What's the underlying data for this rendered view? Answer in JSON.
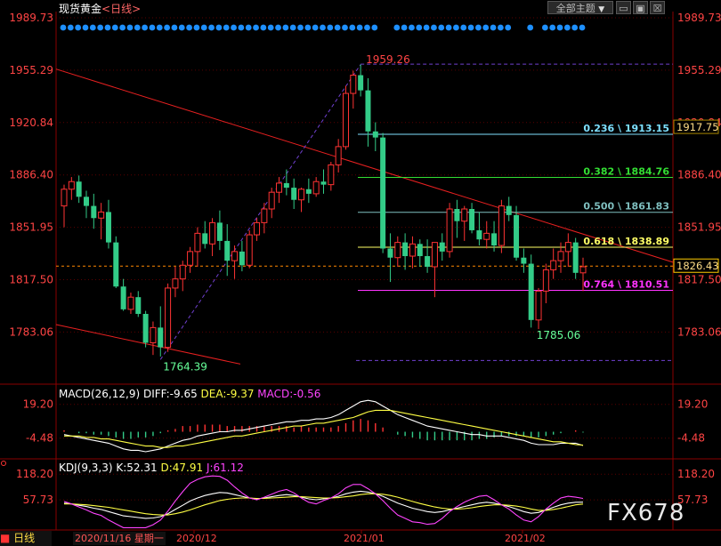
{
  "window": {
    "symbol": "现货黄金",
    "period": "<日线>",
    "panel_title": "日线"
  },
  "toolbar": {
    "dropdown_label": "全部主题",
    "icons": [
      "chevron-down-icon",
      "minimize-icon",
      "restore-icon",
      "close-icon"
    ]
  },
  "watermark": "FX678",
  "colors": {
    "up": "#ff3333",
    "down": "#33cc88",
    "grid": "#5a0000",
    "axis_text": "#ff4444",
    "trendline": "#e82020",
    "channel_dashed": "#7040d0",
    "bg": "#000000"
  },
  "status_bar": {
    "date": "2020/11/16 星期一",
    "x_labels": [
      "2020/12",
      "2021/01",
      "2021/02"
    ]
  },
  "chart_data": [
    {
      "type": "candlestick",
      "title": "现货黄金 日线",
      "ylim": [
        1764.0,
        1989.73
      ],
      "y_ticks": [
        1989.73,
        1955.29,
        1920.84,
        1886.4,
        1851.95,
        1817.5,
        1783.06
      ],
      "last_price": 1826.43,
      "last_price_label": "1826.43",
      "price_tag_1917": "1917.75",
      "annotations": {
        "high": "1959.26",
        "low": "1764.39",
        "low2": "1785.06"
      },
      "fibonacci": [
        {
          "label": "0.236 \\ 1913.15",
          "value": 1913.15,
          "color": "#7fe0ff"
        },
        {
          "label": "0.382 \\ 1884.76",
          "value": 1884.76,
          "color": "#33dd33"
        },
        {
          "label": "0.500 \\ 1861.83",
          "value": 1861.83,
          "color": "#7fbfbf"
        },
        {
          "label": "0.618 \\ 1838.89",
          "value": 1838.89,
          "color": "#ffff66"
        },
        {
          "label": "0.764 \\ 1810.51",
          "value": 1810.51,
          "color": "#ff33ff"
        }
      ],
      "candles": [
        [
          1866,
          1880,
          1852,
          1877
        ],
        [
          1877,
          1885,
          1870,
          1882
        ],
        [
          1882,
          1886,
          1868,
          1872
        ],
        [
          1872,
          1876,
          1858,
          1866
        ],
        [
          1866,
          1874,
          1851,
          1858
        ],
        [
          1858,
          1868,
          1844,
          1862
        ],
        [
          1862,
          1870,
          1838,
          1842
        ],
        [
          1842,
          1846,
          1812,
          1813
        ],
        [
          1813,
          1818,
          1797,
          1798
        ],
        [
          1798,
          1809,
          1795,
          1806
        ],
        [
          1806,
          1810,
          1793,
          1795
        ],
        [
          1795,
          1797,
          1773,
          1776
        ],
        [
          1776,
          1790,
          1768,
          1786
        ],
        [
          1786,
          1800,
          1767,
          1773
        ],
        [
          1773,
          1815,
          1770,
          1812
        ],
        [
          1812,
          1826,
          1806,
          1818
        ],
        [
          1818,
          1830,
          1810,
          1827
        ],
        [
          1827,
          1839,
          1822,
          1836
        ],
        [
          1836,
          1852,
          1826,
          1848
        ],
        [
          1848,
          1856,
          1838,
          1841
        ],
        [
          1841,
          1858,
          1833,
          1855
        ],
        [
          1855,
          1863,
          1837,
          1843
        ],
        [
          1843,
          1854,
          1820,
          1830
        ],
        [
          1830,
          1840,
          1818,
          1836
        ],
        [
          1836,
          1843,
          1823,
          1827
        ],
        [
          1827,
          1850,
          1825,
          1847
        ],
        [
          1847,
          1858,
          1843,
          1855
        ],
        [
          1855,
          1868,
          1848,
          1864
        ],
        [
          1864,
          1878,
          1858,
          1875
        ],
        [
          1875,
          1885,
          1868,
          1881
        ],
        [
          1881,
          1890,
          1873,
          1878
        ],
        [
          1878,
          1884,
          1864,
          1870
        ],
        [
          1870,
          1878,
          1862,
          1877
        ],
        [
          1877,
          1884,
          1868,
          1874
        ],
        [
          1874,
          1885,
          1872,
          1882
        ],
        [
          1882,
          1890,
          1874,
          1880
        ],
        [
          1880,
          1895,
          1876,
          1893
        ],
        [
          1893,
          1910,
          1888,
          1905
        ],
        [
          1905,
          1945,
          1903,
          1940
        ],
        [
          1940,
          1955,
          1930,
          1952
        ],
        [
          1952,
          1959,
          1938,
          1942
        ],
        [
          1942,
          1950,
          1905,
          1915
        ],
        [
          1915,
          1921,
          1902,
          1911
        ],
        [
          1911,
          1914,
          1835,
          1838
        ],
        [
          1838,
          1848,
          1816,
          1832
        ],
        [
          1832,
          1846,
          1826,
          1842
        ],
        [
          1842,
          1848,
          1824,
          1833
        ],
        [
          1833,
          1846,
          1825,
          1841
        ],
        [
          1841,
          1844,
          1826,
          1833
        ],
        [
          1833,
          1844,
          1822,
          1826
        ],
        [
          1826,
          1838,
          1806,
          1842
        ],
        [
          1842,
          1848,
          1830,
          1836
        ],
        [
          1836,
          1868,
          1832,
          1864
        ],
        [
          1864,
          1870,
          1845,
          1856
        ],
        [
          1856,
          1866,
          1843,
          1864
        ],
        [
          1864,
          1868,
          1848,
          1850
        ],
        [
          1850,
          1862,
          1840,
          1844
        ],
        [
          1844,
          1856,
          1838,
          1848
        ],
        [
          1848,
          1856,
          1836,
          1840
        ],
        [
          1840,
          1870,
          1835,
          1866
        ],
        [
          1866,
          1872,
          1856,
          1860
        ],
        [
          1860,
          1866,
          1830,
          1832
        ],
        [
          1832,
          1838,
          1822,
          1828
        ],
        [
          1828,
          1834,
          1786,
          1791
        ],
        [
          1791,
          1812,
          1785,
          1810
        ],
        [
          1810,
          1828,
          1802,
          1824
        ],
        [
          1824,
          1838,
          1818,
          1830
        ],
        [
          1830,
          1842,
          1822,
          1836
        ],
        [
          1836,
          1848,
          1826,
          1842
        ],
        [
          1842,
          1845,
          1818,
          1822
        ],
        [
          1822,
          1832,
          1810,
          1826
        ]
      ]
    },
    {
      "type": "macd",
      "title": "MACD(26,12,9)",
      "params": "MACD(26,12,9)",
      "diff_label": "DIFF:-9.65",
      "dea_label": "DEA:-9.37",
      "macd_label": "MACD:-0.56",
      "ylim": [
        -14.0,
        24.0
      ],
      "y_ticks": [
        19.2,
        -4.48
      ],
      "diff": [
        -2,
        -3,
        -4,
        -5,
        -6,
        -7,
        -8,
        -10,
        -12,
        -13,
        -13,
        -14,
        -13,
        -12,
        -10,
        -8,
        -6,
        -5,
        -3,
        -2,
        -1,
        0,
        0,
        1,
        1,
        2,
        3,
        4,
        5,
        6,
        7,
        7,
        8,
        8,
        9,
        9,
        10,
        12,
        15,
        18,
        21,
        22,
        21,
        18,
        15,
        12,
        10,
        8,
        6,
        4,
        3,
        2,
        1,
        0,
        -1,
        -2,
        -2,
        -3,
        -3,
        -3,
        -4,
        -5,
        -6,
        -8,
        -9,
        -9,
        -9,
        -8,
        -8,
        -8,
        -9.65
      ],
      "dea": [
        -3,
        -3,
        -3,
        -4,
        -4,
        -5,
        -5,
        -6,
        -7,
        -8,
        -9,
        -10,
        -10,
        -11,
        -11,
        -10,
        -10,
        -9,
        -8,
        -7,
        -6,
        -5,
        -4,
        -3,
        -3,
        -2,
        -1,
        0,
        1,
        2,
        3,
        4,
        4,
        5,
        6,
        6,
        7,
        8,
        9,
        10,
        12,
        14,
        15,
        15,
        15,
        14,
        13,
        12,
        11,
        10,
        9,
        8,
        7,
        6,
        5,
        4,
        3,
        2,
        1,
        0,
        -1,
        -2,
        -3,
        -4,
        -5,
        -6,
        -7,
        -7,
        -8,
        -9,
        -9.37
      ],
      "hist": [
        1,
        0,
        -1,
        -1,
        -2,
        -2,
        -3,
        -4,
        -5,
        -5,
        -4,
        -4,
        -3,
        -1,
        1,
        2,
        4,
        4,
        5,
        5,
        5,
        5,
        4,
        4,
        4,
        4,
        4,
        4,
        4,
        4,
        4,
        3,
        4,
        3,
        3,
        3,
        3,
        4,
        6,
        8,
        9,
        8,
        6,
        3,
        0,
        -2,
        -3,
        -4,
        -5,
        -6,
        -6,
        -6,
        -6,
        -6,
        -6,
        -6,
        -5,
        -5,
        -4,
        -3,
        -3,
        -3,
        -3,
        -4,
        -4,
        -3,
        -2,
        -1,
        0,
        1,
        -0.56
      ]
    },
    {
      "type": "kdj",
      "title": "KDJ(9,3,3)",
      "params": "KDJ(9,3,3)",
      "k_label": "K:52.31",
      "d_label": "D:47.91",
      "j_label": "J:61.12",
      "ylim": [
        -5.0,
        125.0
      ],
      "y_ticks": [
        118.2,
        57.73
      ],
      "k": [
        50,
        48,
        45,
        42,
        38,
        35,
        30,
        25,
        20,
        18,
        16,
        14,
        15,
        18,
        25,
        35,
        45,
        55,
        62,
        68,
        72,
        75,
        74,
        70,
        66,
        62,
        60,
        62,
        65,
        68,
        70,
        68,
        64,
        60,
        58,
        60,
        62,
        66,
        72,
        76,
        78,
        76,
        72,
        66,
        58,
        50,
        44,
        38,
        34,
        30,
        28,
        30,
        34,
        38,
        42,
        46,
        50,
        52,
        50,
        46,
        42,
        36,
        30,
        26,
        28,
        34,
        40,
        46,
        50,
        52,
        52.31
      ],
      "d": [
        48,
        48,
        47,
        46,
        44,
        42,
        40,
        37,
        34,
        31,
        28,
        25,
        23,
        22,
        22,
        25,
        29,
        34,
        40,
        46,
        51,
        56,
        59,
        61,
        62,
        62,
        61,
        61,
        62,
        63,
        64,
        65,
        65,
        64,
        63,
        62,
        62,
        63,
        65,
        67,
        70,
        72,
        72,
        71,
        68,
        64,
        59,
        54,
        49,
        45,
        41,
        38,
        36,
        36,
        37,
        39,
        42,
        44,
        46,
        46,
        45,
        43,
        40,
        36,
        33,
        33,
        35,
        38,
        42,
        46,
        47.91
      ],
      "j": [
        54,
        48,
        41,
        34,
        26,
        21,
        10,
        1,
        -8,
        -8,
        -8,
        -8,
        -1,
        10,
        31,
        55,
        77,
        97,
        106,
        112,
        114,
        113,
        104,
        88,
        74,
        62,
        58,
        64,
        71,
        78,
        82,
        74,
        62,
        52,
        48,
        56,
        62,
        72,
        86,
        94,
        94,
        84,
        72,
        56,
        38,
        22,
        14,
        6,
        4,
        0,
        2,
        14,
        30,
        42,
        52,
        60,
        66,
        68,
        58,
        46,
        36,
        22,
        10,
        6,
        18,
        36,
        50,
        62,
        66,
        64,
        61.12
      ]
    }
  ]
}
